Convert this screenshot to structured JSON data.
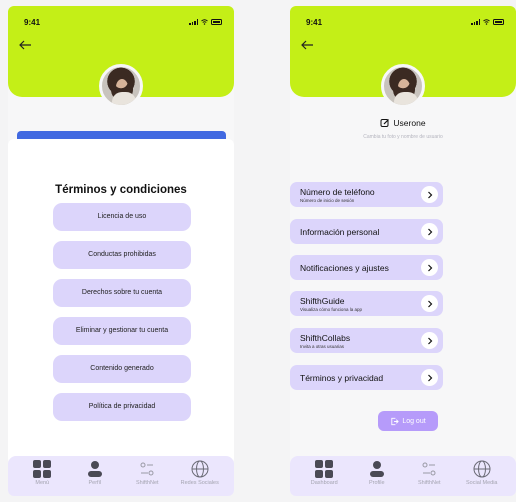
{
  "status_bar": {
    "time": "9:41"
  },
  "left_screen": {
    "title": "Términos y condiciones",
    "items": [
      "Licencia de uso",
      "Conductas prohibidas",
      "Derechos sobre tu cuenta",
      "Eliminar y gestionar tu cuenta",
      "Contenido generado",
      "Política de privacidad"
    ],
    "nav": [
      {
        "label": "Menú",
        "icon": "grid-icon"
      },
      {
        "label": "Perfil",
        "icon": "user-icon"
      },
      {
        "label": "ShifthNet",
        "icon": "sliders-icon"
      },
      {
        "label": "Redes Sociales",
        "icon": "globe-icon"
      }
    ]
  },
  "right_screen": {
    "username": "Userone",
    "hint": "Cambia tu foto y nombre de usuario",
    "items": [
      {
        "label": "Número de teléfono",
        "sub": "Número de inicio de sesión"
      },
      {
        "label": "Información personal",
        "sub": ""
      },
      {
        "label": "Notificaciones y ajustes",
        "sub": ""
      },
      {
        "label": "ShifthGuide",
        "sub": "Visualiza cómo funciona la app"
      },
      {
        "label": "ShifthCollabs",
        "sub": "Invita a otras usuarias"
      },
      {
        "label": "Términos y privacidad",
        "sub": ""
      }
    ],
    "logout": "Log out",
    "nav": [
      {
        "label": "Dashboard",
        "icon": "grid-icon"
      },
      {
        "label": "Profile",
        "icon": "user-icon"
      },
      {
        "label": "ShifthNet",
        "icon": "sliders-icon"
      },
      {
        "label": "Social Media",
        "icon": "globe-icon"
      }
    ]
  },
  "colors": {
    "accent_green": "#c4ef17",
    "pill_lavender": "#dcd5fb",
    "logout_purple": "#b69bfa",
    "strip_blue": "#4169e1"
  }
}
